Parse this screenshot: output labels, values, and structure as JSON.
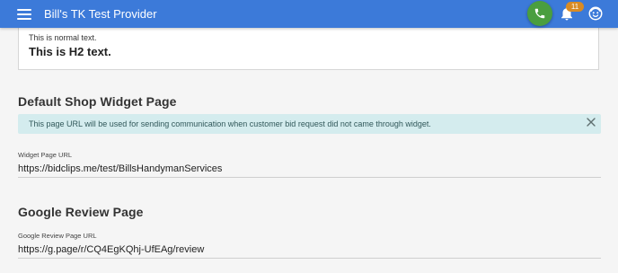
{
  "header": {
    "title": "Bill's TK Test Provider",
    "notification_count": "11",
    "icons": [
      "menu-icon",
      "phone-icon",
      "bell-icon",
      "face-icon"
    ],
    "bar_color": "#3c7ad9",
    "call_color": "#4a9e3f",
    "badge_color": "#d98b24"
  },
  "preview": {
    "normal_text": "This is normal text.",
    "h2_text": "This is H2 text."
  },
  "widget_section": {
    "title": "Default Shop Widget Page",
    "alert": "This page URL will be used for sending communication when customer bid request did not came through widget.",
    "field_label": "Widget Page URL",
    "field_value": "https://bidclips.me/test/BillsHandymanServices"
  },
  "review_section": {
    "title": "Google Review Page",
    "field_label": "Google Review Page URL",
    "field_value": "https://g.page/r/CQ4EgKQhj-UfEAg/review"
  }
}
